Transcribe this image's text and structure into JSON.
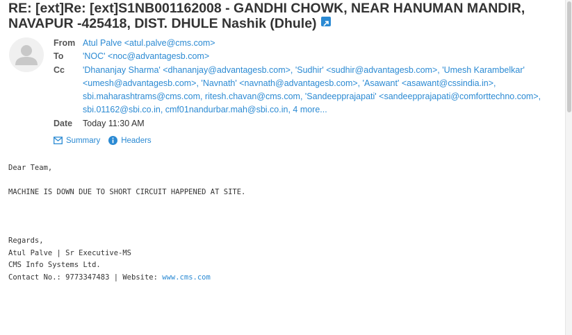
{
  "email": {
    "subject": "RE: [ext]Re: [ext]S1NB001162008 - GANDHI CHOWK, NEAR HANUMAN MANDIR, NAVAPUR -425418, DIST. DHULE Nashik (Dhule)",
    "from_label": "From",
    "from_value": "Atul Palve <atul.palve@cms.com>",
    "to_label": "To",
    "to_value": "'NOC' <noc@advantagesb.com>",
    "cc_label": "Cc",
    "cc_line1": "'Dhananjay Sharma' <dhananjay@advantagesb.com>, 'Sudhir' <sudhir@advantagesb.com>, 'Umesh Karambelkar'",
    "cc_line2": "<umesh@advantagesb.com>, 'Navnath' <navnath@advantagesb.com>, 'Asawant' <asawant@cssindia.in>,",
    "cc_line3": "sbi.maharashtrams@cms.com, ritesh.chavan@cms.com, 'Sandeepprajapati' <sandeepprajapati@comforttechno.com>,",
    "cc_line4": "sbi.01162@sbi.co.in, cmf01nandurbar.mah@sbi.co.in, 4 more...",
    "date_label": "Date",
    "date_value": "Today 11:30 AM",
    "summary_label": "Summary",
    "headers_label": "Headers"
  },
  "body": {
    "greeting": "Dear Team,",
    "message": "MACHINE IS DOWN DUE TO SHORT CIRCUIT HAPPENED AT SITE.",
    "regards": "Regards,",
    "sig_name": "Atul Palve | Sr Executive-MS",
    "sig_company": "CMS Info Systems Ltd.",
    "sig_contact": "Contact No.: 9773347483 | Website: ",
    "sig_website": "www.cms.com"
  },
  "colors": {
    "link": "#2b8ad3",
    "text": "#333333"
  }
}
